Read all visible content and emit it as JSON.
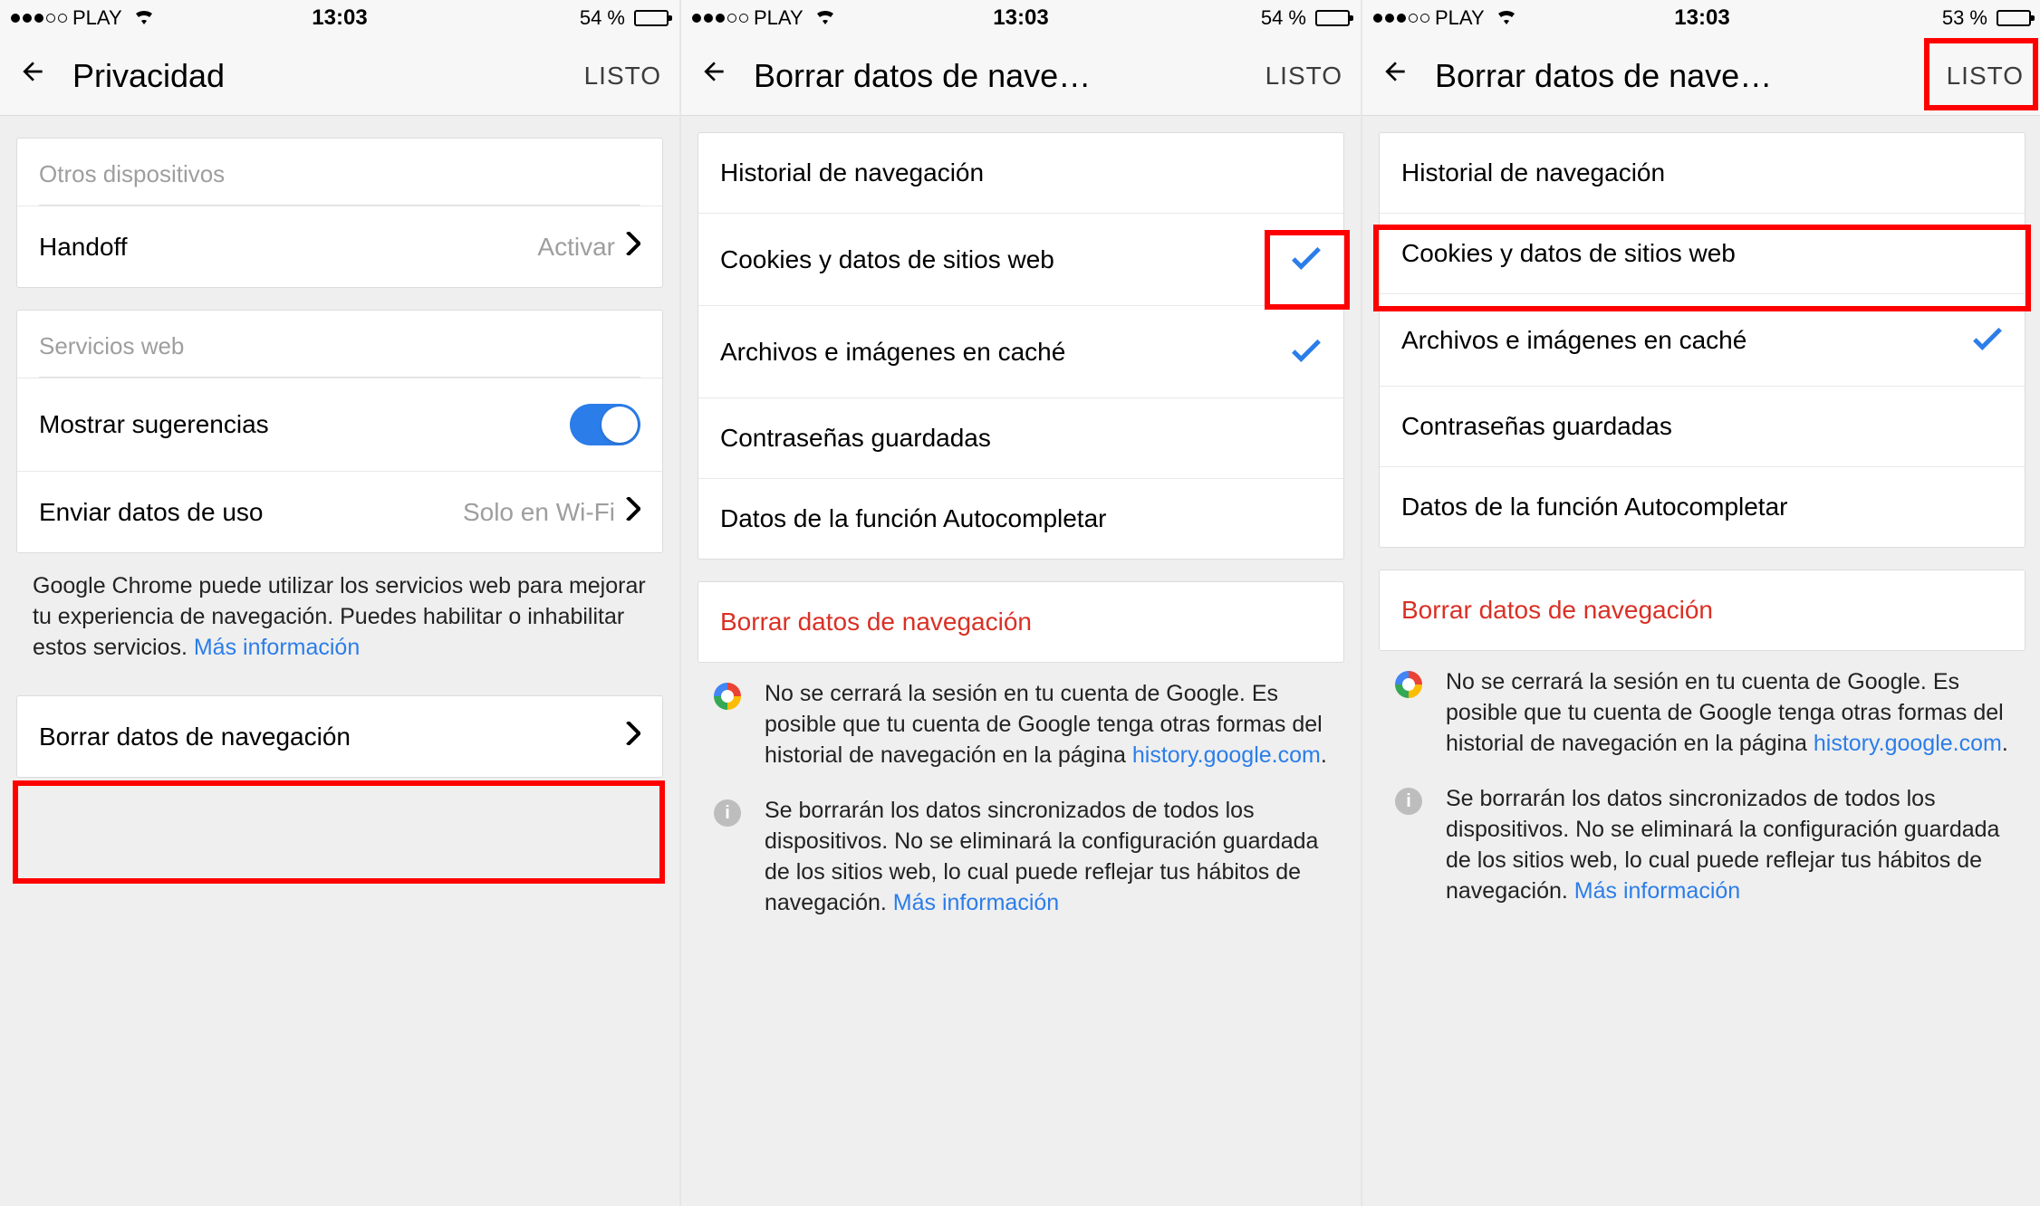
{
  "phones": [
    {
      "status": {
        "carrier": "PLAY",
        "time": "13:03",
        "battery_label": "54 %",
        "battery_pct": 54
      },
      "nav": {
        "title": "Privacidad",
        "done": "LISTO"
      },
      "groups": [
        {
          "header": "Otros dispositivos",
          "rows": [
            {
              "label": "Handoff",
              "value": "Activar",
              "chevron": true
            }
          ]
        },
        {
          "header": "Servicios web",
          "rows": [
            {
              "label": "Mostrar sugerencias",
              "toggle": true
            },
            {
              "label": "Enviar datos de uso",
              "value": "Solo en Wi-Fi",
              "chevron": true
            }
          ]
        }
      ],
      "desc": {
        "text": "Google Chrome puede utilizar los servicios web para mejorar tu experiencia de navegación. Puedes habilitar o inhabilitar estos servicios. ",
        "link": "Más información"
      },
      "action_group": {
        "rows": [
          {
            "label": "Borrar datos de navegación",
            "chevron": true
          }
        ]
      }
    },
    {
      "status": {
        "carrier": "PLAY",
        "time": "13:03",
        "battery_label": "54 %",
        "battery_pct": 54
      },
      "nav": {
        "title": "Borrar datos de nave…",
        "done": "LISTO"
      },
      "options": [
        {
          "label": "Historial de navegación",
          "checked": false
        },
        {
          "label": "Cookies y datos de sitios web",
          "checked": true
        },
        {
          "label": "Archivos e imágenes en caché",
          "checked": true
        },
        {
          "label": "Contraseñas guardadas",
          "checked": false
        },
        {
          "label": "Datos de la función Autocompletar",
          "checked": false
        }
      ],
      "clear_action": "Borrar datos de navegación",
      "info_google": {
        "text": "No se cerrará la sesión en tu cuenta de Google. Es posible que tu cuenta de Google tenga otras formas del historial de navegación en la página ",
        "link": "history.google.com",
        "suffix": "."
      },
      "info_sync": {
        "text": "Se borrarán los datos sincronizados de todos los dispositivos. No se eliminará la configuración guardada de los sitios web, lo cual puede reflejar tus hábitos de navegación. ",
        "link": "Más información"
      }
    },
    {
      "status": {
        "carrier": "PLAY",
        "time": "13:03",
        "battery_label": "53 %",
        "battery_pct": 53
      },
      "nav": {
        "title": "Borrar datos de nave…",
        "done": "LISTO"
      },
      "options": [
        {
          "label": "Historial de navegación",
          "checked": false
        },
        {
          "label": "Cookies y datos de sitios web",
          "checked": false
        },
        {
          "label": "Archivos e imágenes en caché",
          "checked": true
        },
        {
          "label": "Contraseñas guardadas",
          "checked": false
        },
        {
          "label": "Datos de la función Autocompletar",
          "checked": false
        }
      ],
      "clear_action": "Borrar datos de navegación",
      "info_google": {
        "text": "No se cerrará la sesión en tu cuenta de Google. Es posible que tu cuenta de Google tenga otras formas del historial de navegación en la página ",
        "link": "history.google.com",
        "suffix": "."
      },
      "info_sync": {
        "text": "Se borrarán los datos sincronizados de todos los dispositivos. No se eliminará la configuración guardada de los sitios web, lo cual puede reflejar tus hábitos de navegación. ",
        "link": "Más información"
      }
    }
  ]
}
